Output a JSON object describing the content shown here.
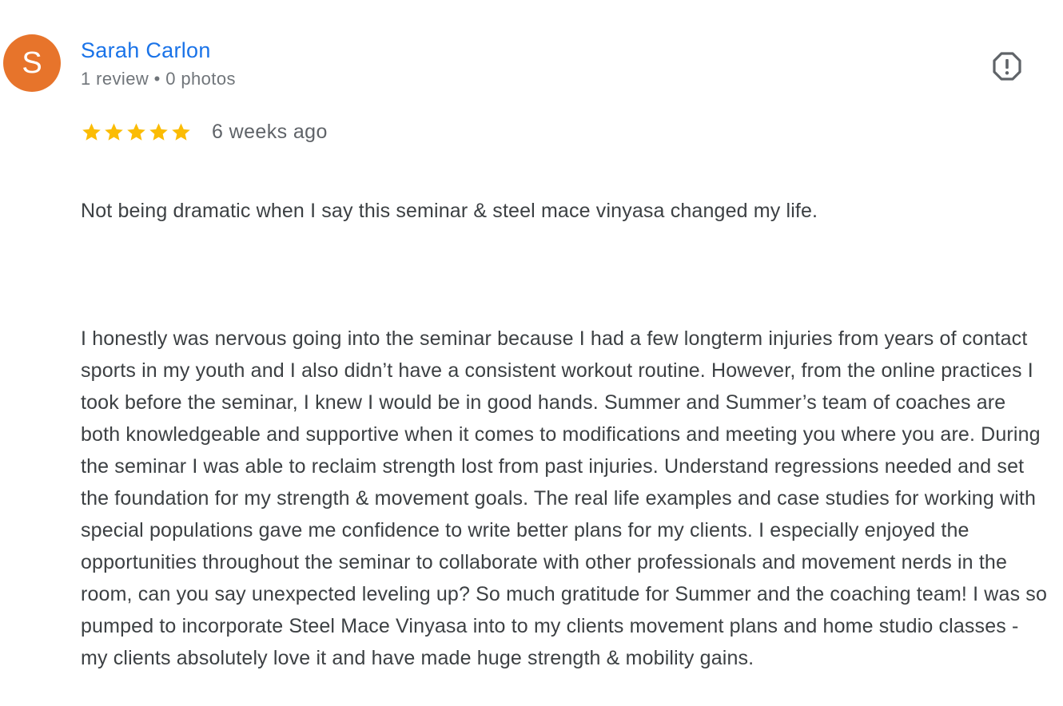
{
  "reviewer": {
    "avatar_initial": "S",
    "avatar_color": "#e7742b",
    "name": "Sarah Carlon",
    "meta": "1 review • 0 photos",
    "name_color": "#1a73e8"
  },
  "report_button": {
    "icon": "report-flag-icon",
    "label": "Report review"
  },
  "rating": {
    "stars": 5,
    "max_stars": 5,
    "star_color": "#fbbc04",
    "date": "6 weeks ago"
  },
  "review": {
    "paragraph_1": "Not being dramatic when I say this seminar & steel mace vinyasa changed my life.",
    "paragraph_2": "I honestly was nervous going into the seminar because I had a few longterm injuries from years of contact sports in my youth and I also didn’t have a consistent workout routine. However, from the online practices I took before the seminar, I knew I would be in good hands. Summer and Summer’s team of coaches are both knowledgeable and supportive when it comes to modifications and meeting you where you are. During the seminar I was able to reclaim strength lost from past injuries. Understand regressions needed and set the foundation for my strength & movement goals. The real life examples and case studies for working with special populations gave me confidence to write better plans for my clients. I especially enjoyed the opportunities throughout the seminar to collaborate with other professionals and movement nerds in the room, can you say unexpected leveling up? So much gratitude for Summer and the coaching team! I was so pumped to incorporate Steel Mace Vinyasa into to my clients movement plans and home studio classes - my clients absolutely love it and have made huge strength & mobility gains."
  }
}
